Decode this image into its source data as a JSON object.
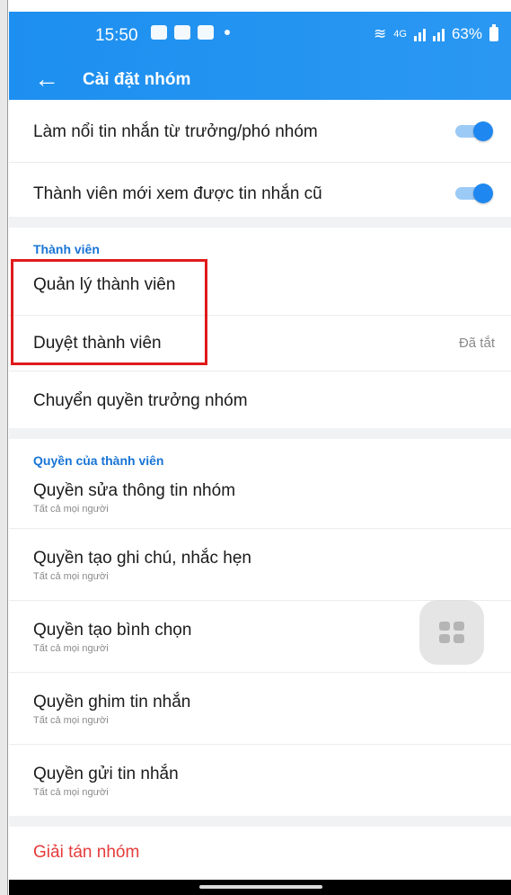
{
  "status_bar": {
    "time": "15:50",
    "network": "4G",
    "battery": "63%"
  },
  "app_bar": {
    "title": "Cài đặt nhóm"
  },
  "settings_top": [
    {
      "label": "Làm nổi tin nhắn từ trưởng/phó nhóm",
      "toggle_on": true
    },
    {
      "label": "Thành viên mới xem được tin nhắn cũ",
      "toggle_on": true
    }
  ],
  "members": {
    "section_title": "Thành viên",
    "items": [
      {
        "label": "Quản lý thành viên",
        "value": ""
      },
      {
        "label": "Duyệt thành viên",
        "value": "Đã tắt"
      },
      {
        "label": "Chuyển quyền trưởng nhóm",
        "value": ""
      }
    ]
  },
  "member_permissions": {
    "section_title": "Quyền của thành viên",
    "items": [
      {
        "label": "Quyền sửa thông tin nhóm",
        "sub": "Tất cả mọi người"
      },
      {
        "label": "Quyền tạo ghi chú, nhắc hẹn",
        "sub": "Tất cả mọi người"
      },
      {
        "label": "Quyền tạo bình chọn",
        "sub": "Tất cả mọi người"
      },
      {
        "label": "Quyền ghim tin nhắn",
        "sub": "Tất cả mọi người"
      },
      {
        "label": "Quyền gửi tin nhắn",
        "sub": "Tất cả mọi người"
      }
    ]
  },
  "danger": {
    "disband_label": "Giải tán nhóm"
  },
  "colors": {
    "accent": "#1e88f0",
    "danger": "#e63b3b",
    "highlight": "#e01b1b"
  },
  "icons": {
    "back": "back-arrow-icon",
    "toggle": "toggle-switch-icon",
    "floating": "grid-menu-icon"
  }
}
